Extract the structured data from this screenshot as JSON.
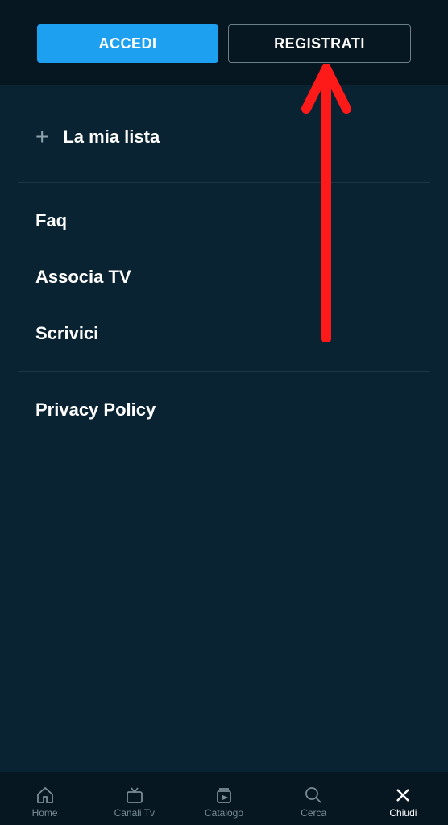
{
  "header": {
    "login_label": "ACCEDI",
    "register_label": "REGISTRATI"
  },
  "menu": {
    "my_list": "La mia lista",
    "faq": "Faq",
    "associate_tv": "Associa TV",
    "write_us": "Scrivici",
    "privacy_policy": "Privacy Policy"
  },
  "nav": {
    "home": "Home",
    "channels": "Canali Tv",
    "catalog": "Catalogo",
    "search": "Cerca",
    "close": "Chiudi"
  },
  "colors": {
    "accent": "#1ea0f0",
    "background": "#0a2332",
    "header_bg": "#061722",
    "annotation": "#ff1a1a"
  }
}
